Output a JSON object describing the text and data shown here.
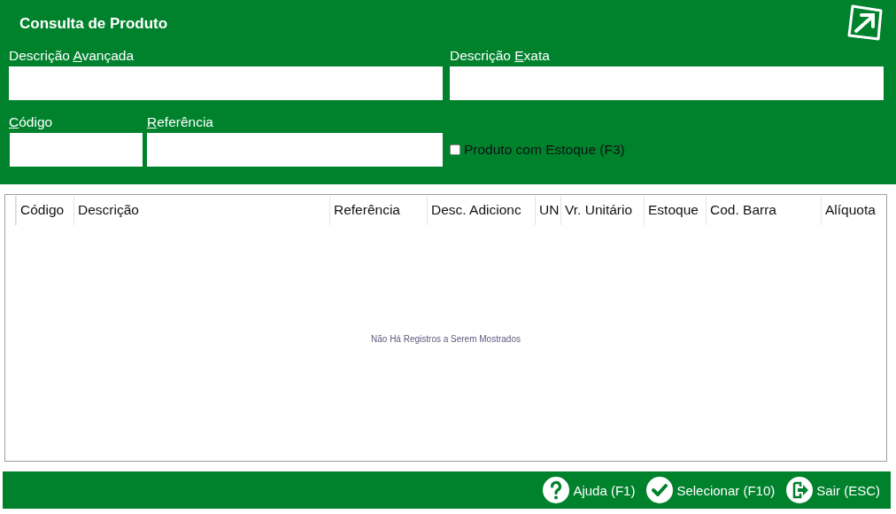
{
  "window": {
    "title": "Consulta de Produto"
  },
  "fields": [
    {
      "label_before": "Descrição ",
      "access_key": "A",
      "label_after": "vançada"
    },
    {
      "label_before": "Descrição ",
      "access_key": "E",
      "label_after": "xata"
    },
    {
      "access_key": "C",
      "label_after": "ódigo"
    },
    {
      "access_key": "R",
      "label_after": "eferência"
    }
  ],
  "stock_filter": {
    "label": "Produto com Estoque (F3)",
    "checked": false
  },
  "table": {
    "columns": [
      "Código",
      "Descrição",
      "Referência",
      "Desc. Adicionc",
      "UN",
      "Vr. Unitário",
      "Estoque",
      "Cod. Barra",
      "Alíquota"
    ],
    "empty_message": "Não Há Registros a Serem Mostrados"
  },
  "buttons": [
    {
      "kind": "help",
      "label": "Ajuda (F1)"
    },
    {
      "kind": "select",
      "label": "Selecionar (F10)"
    },
    {
      "kind": "exit",
      "label": "Sair (ESC)"
    }
  ]
}
